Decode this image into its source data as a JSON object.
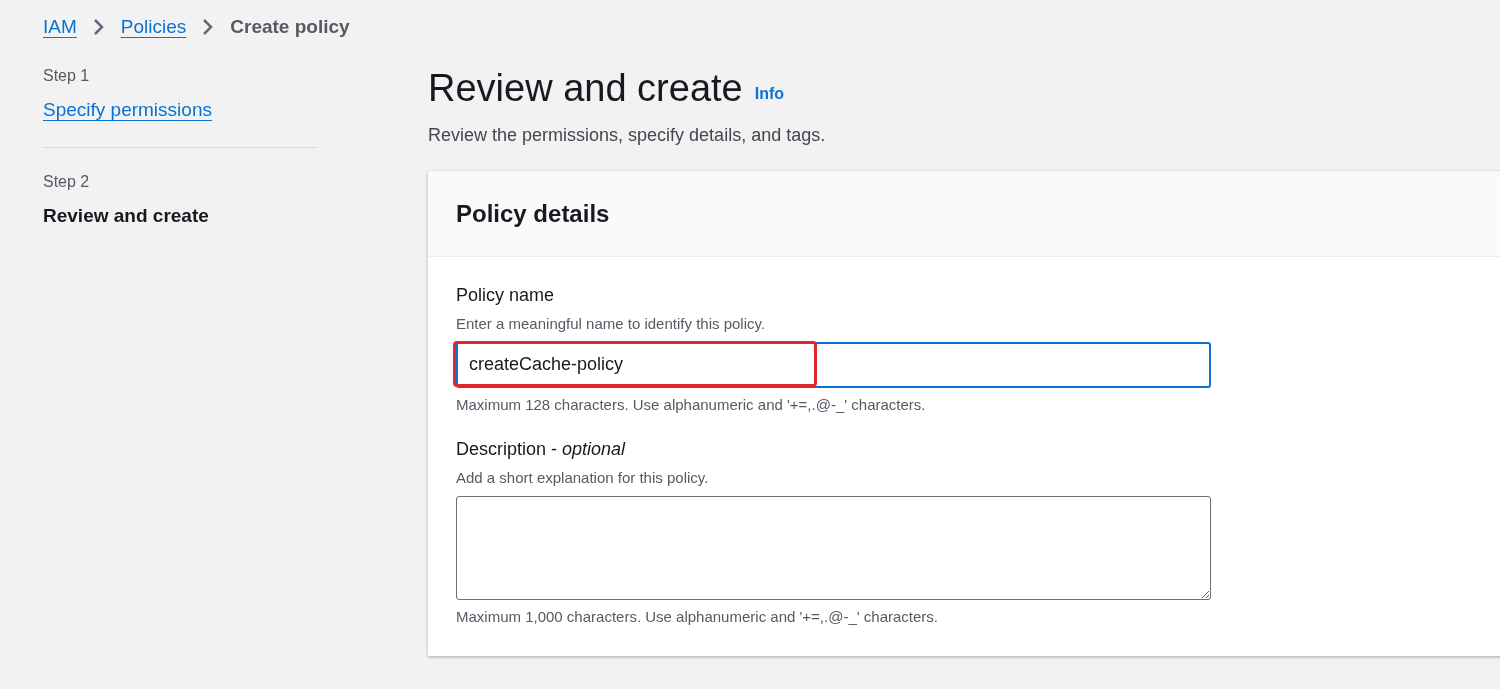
{
  "breadcrumbs": [
    {
      "label": "IAM",
      "link": true
    },
    {
      "label": "Policies",
      "link": true
    },
    {
      "label": "Create policy",
      "link": false
    }
  ],
  "steps": [
    {
      "step": "Step 1",
      "label": "Specify permissions",
      "selected": false
    },
    {
      "step": "Step 2",
      "label": "Review and create",
      "selected": true
    }
  ],
  "header": {
    "title": "Review and create",
    "info": "Info",
    "description": "Review the permissions, specify details, and tags."
  },
  "policy_details": {
    "title": "Policy details",
    "policy_name": {
      "label": "Policy name",
      "hint": "Enter a meaningful name to identify this policy.",
      "value": "createCache-policy",
      "constraint": "Maximum 128 characters. Use alphanumeric and '+=,.@-_' characters."
    },
    "description": {
      "label": "Description - *optional*",
      "hint": "Add a short explanation for this policy.",
      "constraint": "Maximum 1,000 characters. Use alphanumeric and '+=,.@-_' characters."
    }
  }
}
